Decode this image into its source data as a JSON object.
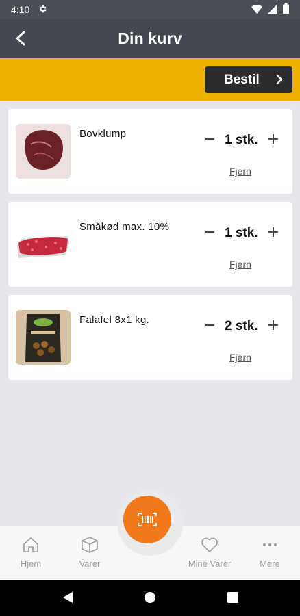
{
  "status_bar": {
    "time": "4:10"
  },
  "header": {
    "title": "Din kurv"
  },
  "order": {
    "label": "Bestil"
  },
  "cart": {
    "items": [
      {
        "name": "Bovklump",
        "quantity": "1 stk.",
        "remove_label": "Fjern"
      },
      {
        "name": "Småkød max. 10%",
        "quantity": "1 stk.",
        "remove_label": "Fjern"
      },
      {
        "name": "Falafel 8x1 kg.",
        "quantity": "2 stk.",
        "remove_label": "Fjern"
      }
    ]
  },
  "bottom_nav": {
    "items": [
      {
        "label": "Hjem",
        "icon": "home-icon"
      },
      {
        "label": "Varer",
        "icon": "box-icon"
      },
      {
        "label": "Mine Varer",
        "icon": "heart-icon"
      },
      {
        "label": "Mere",
        "icon": "more-icon"
      }
    ],
    "scan_icon": "barcode-scan-icon"
  },
  "colors": {
    "accent_yellow": "#f0b000",
    "scan_orange": "#f07a1a",
    "header_dark": "#44484e"
  }
}
